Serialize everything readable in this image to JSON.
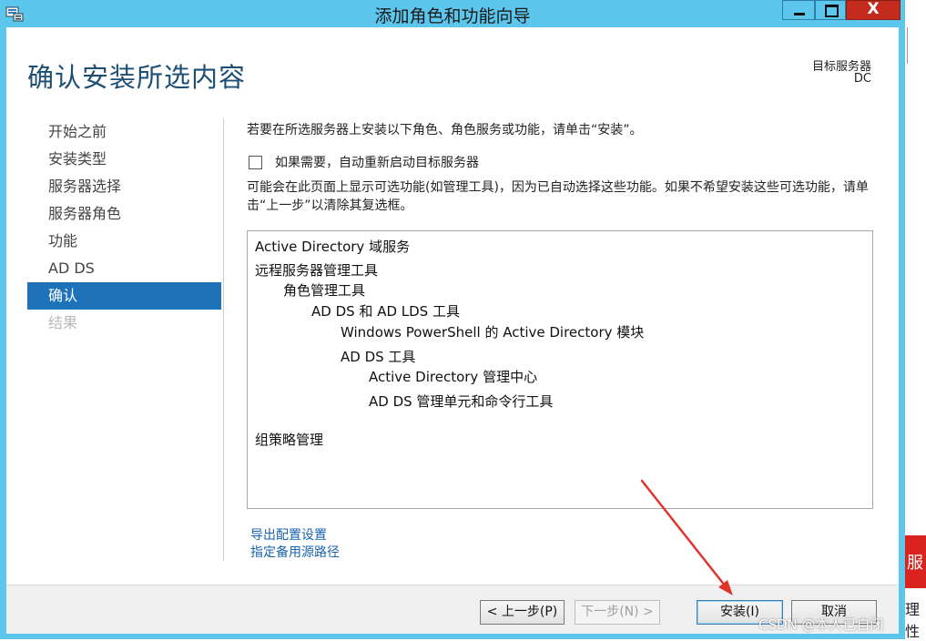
{
  "window": {
    "title": "添加角色和功能向导",
    "minimize_glyph": "—",
    "maximize_glyph": "☐",
    "close_glyph": "X"
  },
  "header": {
    "title": "确认安装所选内容",
    "target_label": "目标服务器",
    "target_name": "DC"
  },
  "nav": {
    "items": [
      {
        "label": "开始之前",
        "state": "normal"
      },
      {
        "label": "安装类型",
        "state": "normal"
      },
      {
        "label": "服务器选择",
        "state": "normal"
      },
      {
        "label": "服务器角色",
        "state": "normal"
      },
      {
        "label": "功能",
        "state": "normal"
      },
      {
        "label": "AD DS",
        "state": "normal"
      },
      {
        "label": "确认",
        "state": "active"
      },
      {
        "label": "结果",
        "state": "disabled"
      }
    ]
  },
  "main": {
    "intro": "若要在所选服务器上安装以下角色、角色服务或功能，请单击“安装”。",
    "restart_checkbox": {
      "label": "如果需要，自动重新启动目标服务器",
      "checked": false
    },
    "info": "可能会在此页面上显示可选功能(如管理工具)，因为已自动选择这些功能。如果不希望安装这些可选功能，请单击“上一步”以清除其复选框。",
    "features": [
      {
        "label": "Active Directory 域服务",
        "level": 0
      },
      {
        "label": "远程服务器管理工具",
        "level": 0
      },
      {
        "label": "角色管理工具",
        "level": 1
      },
      {
        "label": "AD DS 和 AD LDS 工具",
        "level": 2
      },
      {
        "label": "Windows PowerShell 的 Active Directory 模块",
        "level": 3
      },
      {
        "label": "AD DS 工具",
        "level": 3
      },
      {
        "label": "Active Directory 管理中心",
        "level": 4
      },
      {
        "label": "AD DS 管理单元和命令行工具",
        "level": 4
      },
      {
        "label": "组策略管理",
        "level": 0
      }
    ],
    "links": {
      "export": "导出配置设置",
      "alternate_source": "指定备用源路径"
    }
  },
  "footer": {
    "prev": "< 上一步(P)",
    "next": "下一步(N) >",
    "install": "安装(I)",
    "cancel": "取消"
  },
  "background": {
    "red_text": "服",
    "side_text": "理性"
  },
  "watermark": "CSDN @本人已自闭",
  "colors": {
    "titlebar": "#5dc6ec",
    "nav_active": "#1e73b8",
    "page_title": "#1d4f75",
    "link": "#1a63b0",
    "annotation_arrow": "#e0352c"
  }
}
